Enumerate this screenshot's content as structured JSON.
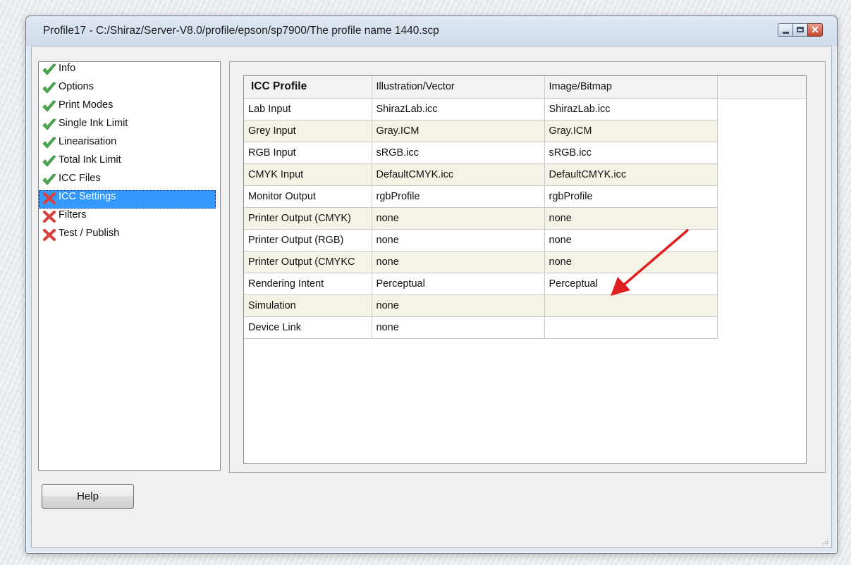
{
  "window": {
    "title": "Profile17 - C:/Shiraz/Server-V8.0/profile/epson/sp7900/The profile name 1440.scp"
  },
  "nav": {
    "items": [
      {
        "label": "Info",
        "status": "done"
      },
      {
        "label": "Options",
        "status": "done"
      },
      {
        "label": "Print Modes",
        "status": "done"
      },
      {
        "label": "Single Ink Limit",
        "status": "done"
      },
      {
        "label": "Linearisation",
        "status": "done"
      },
      {
        "label": "Total Ink Limit",
        "status": "done"
      },
      {
        "label": "ICC Files",
        "status": "done"
      },
      {
        "label": "ICC Settings",
        "status": "incomplete",
        "selected": true
      },
      {
        "label": "Filters",
        "status": "incomplete"
      },
      {
        "label": "Test / Publish",
        "status": "incomplete"
      }
    ]
  },
  "grid": {
    "headers": [
      "ICC Profile",
      "Illustration/Vector",
      "Image/Bitmap"
    ],
    "rows": [
      [
        "Lab Input",
        "ShirazLab.icc",
        "ShirazLab.icc"
      ],
      [
        "Grey Input",
        "Gray.ICM",
        "Gray.ICM"
      ],
      [
        "RGB Input",
        "sRGB.icc",
        "sRGB.icc"
      ],
      [
        "CMYK Input",
        "DefaultCMYK.icc",
        "DefaultCMYK.icc"
      ],
      [
        "Monitor Output",
        "rgbProfile",
        "rgbProfile"
      ],
      [
        "Printer Output (CMYK)",
        "none",
        "none"
      ],
      [
        "Printer Output (RGB)",
        "none",
        "none"
      ],
      [
        "Printer Output (CMYKC",
        "none",
        "none"
      ],
      [
        "Rendering Intent",
        "Perceptual",
        "Perceptual"
      ],
      [
        "Simulation",
        "none",
        ""
      ],
      [
        "Device Link",
        "none",
        ""
      ]
    ]
  },
  "buttons": {
    "help": "Help"
  },
  "colors": {
    "check": "#4caf50",
    "cross": "#d9413b",
    "selection": "#3399ff",
    "row_alt": "#f5f3e6",
    "annotation_arrow": "#e02020"
  },
  "icons": {
    "done": "check-icon",
    "incomplete": "cross-icon"
  }
}
